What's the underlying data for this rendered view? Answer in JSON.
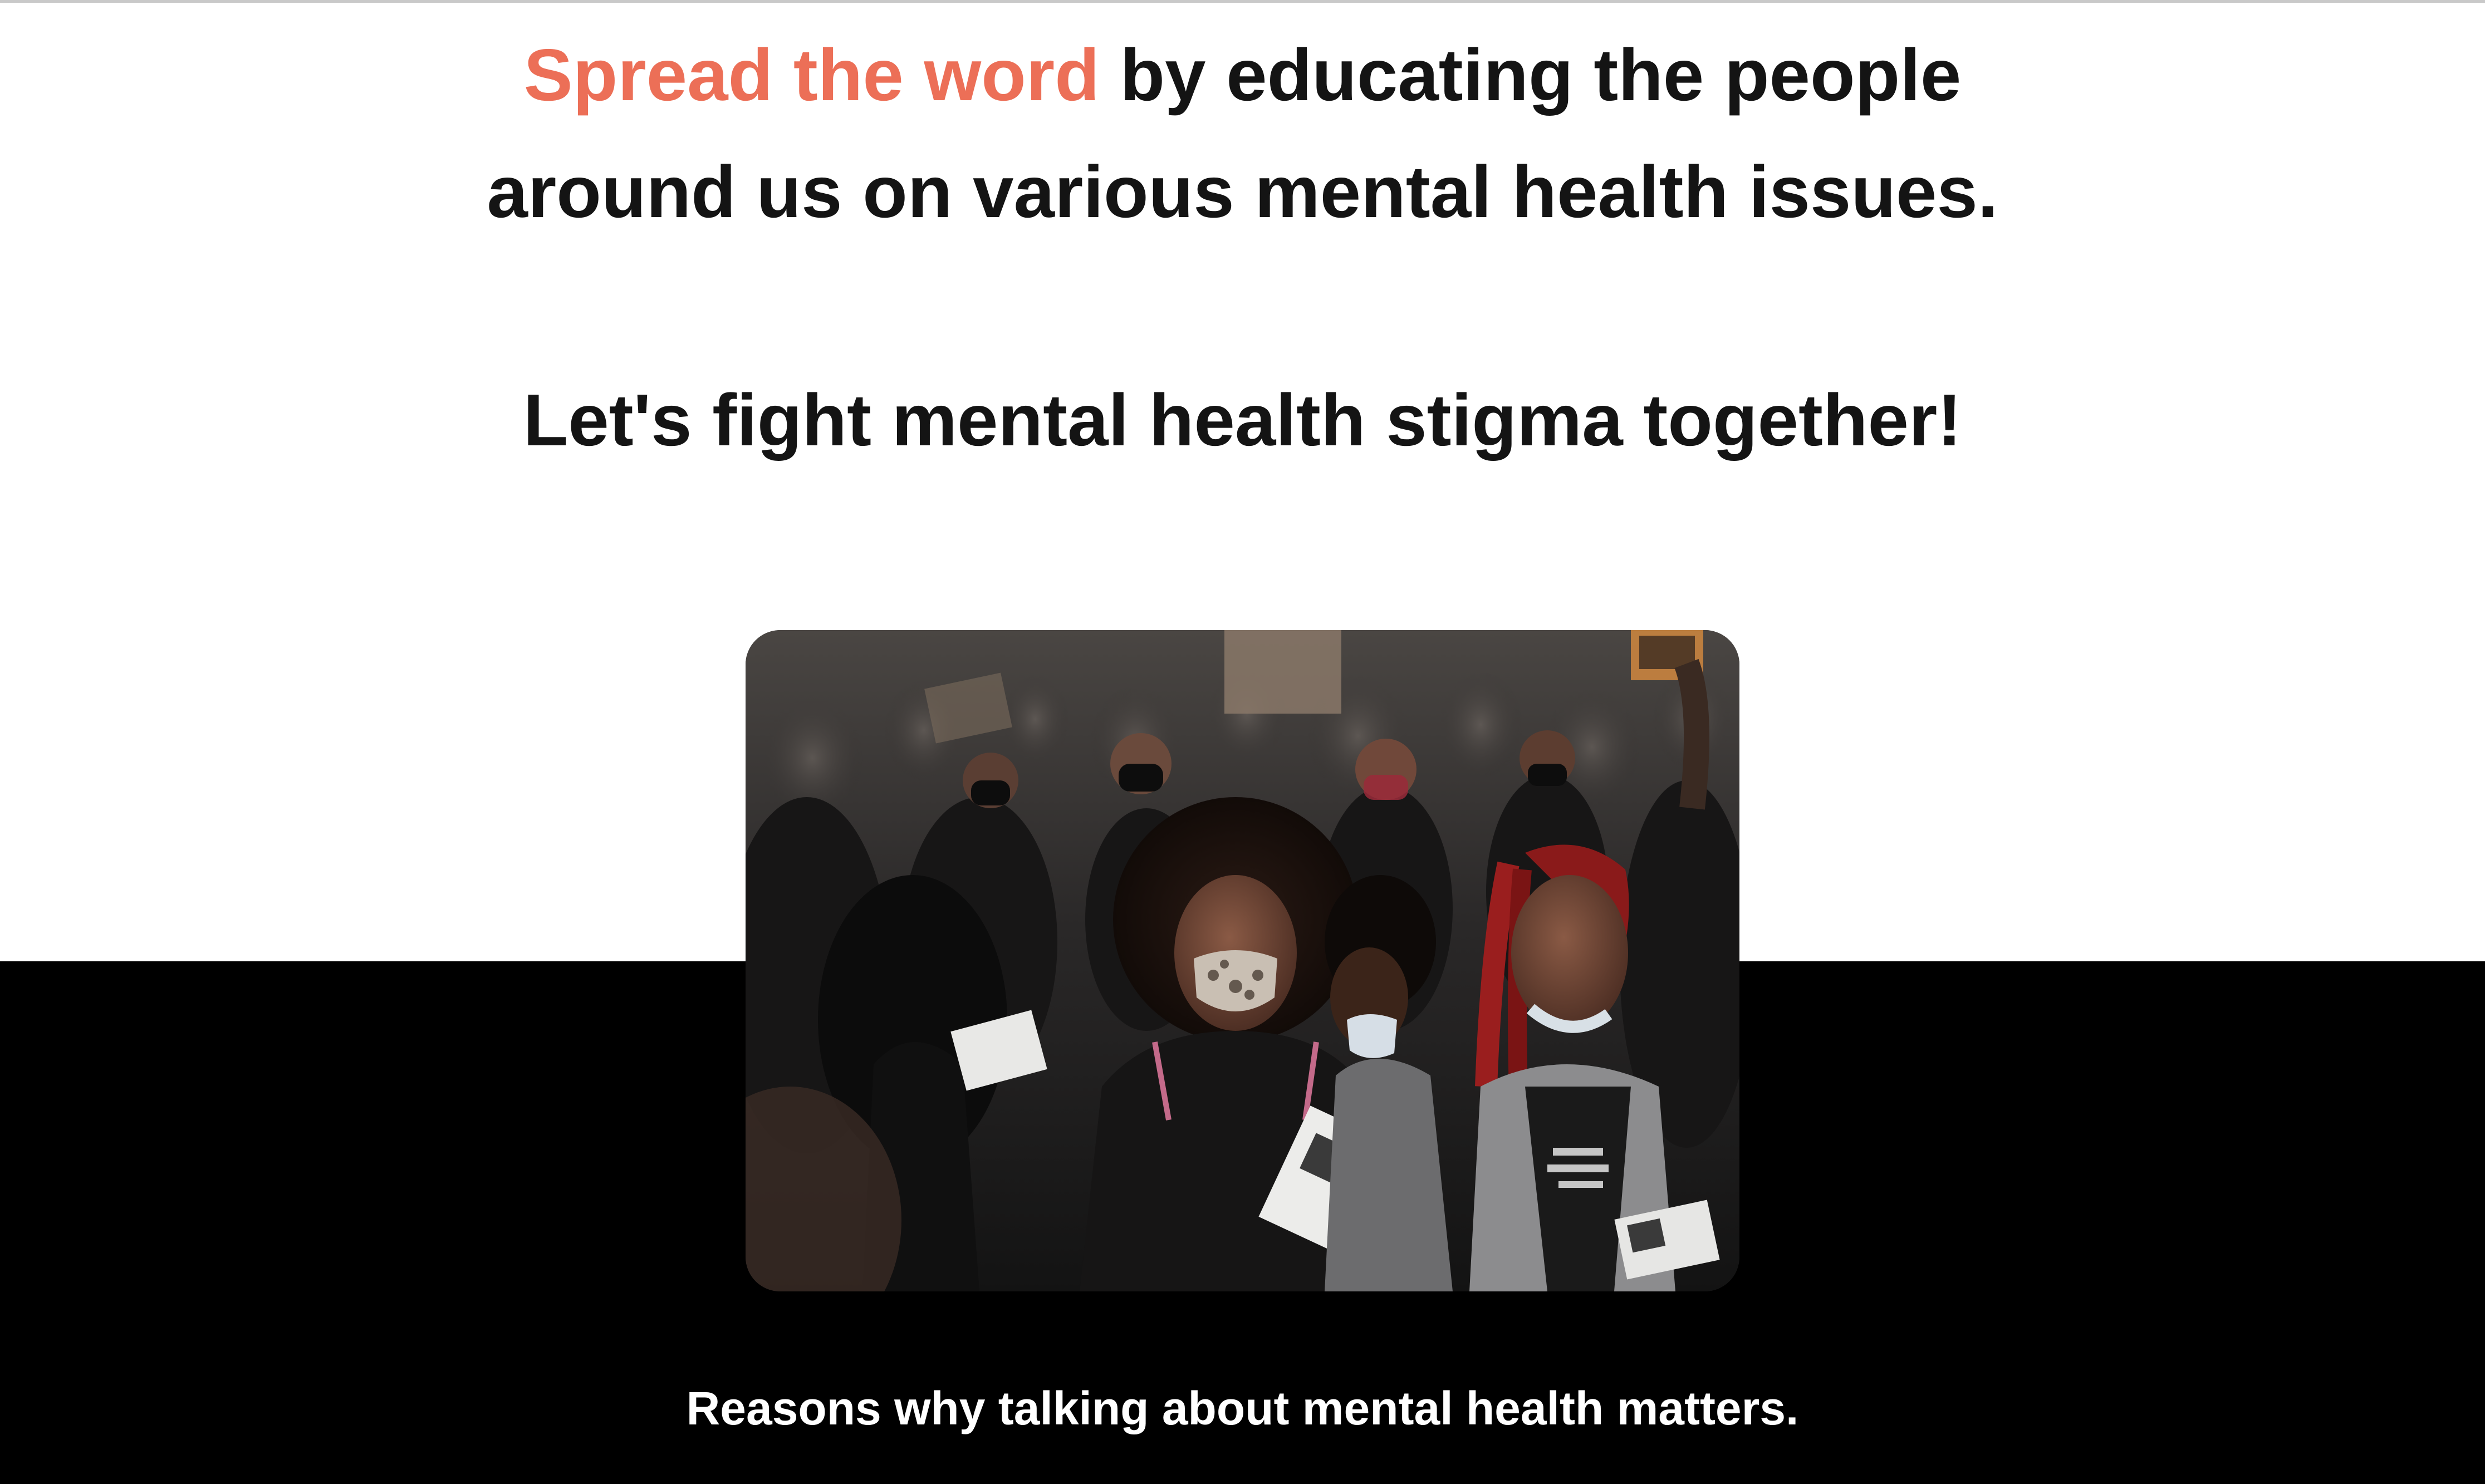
{
  "hero": {
    "headline_accent": "Spread the word",
    "headline_rest": " by educating the people",
    "headline_line2": "around us on various mental health issues.",
    "tagline": "Let's fight mental health stigma together!",
    "accent_color": "#ec6f57",
    "text_color": "#141414"
  },
  "photo": {
    "alt": "Masked protesters in a crowd holding pamphlets"
  },
  "section": {
    "caption": "Reasons why talking about mental health matters.",
    "background_color": "#000000",
    "caption_color": "#ffffff"
  }
}
